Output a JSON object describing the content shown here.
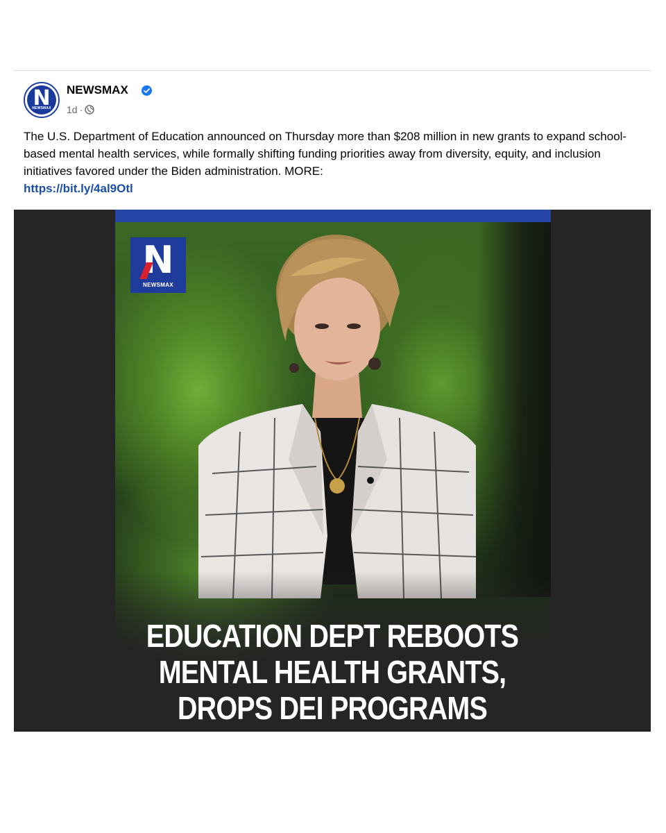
{
  "post": {
    "page_name": "NEWSMAX",
    "timestamp": "1d",
    "separator": "·",
    "verified": true,
    "visibility_icon": "globe-icon",
    "caption": "The U.S. Department of Education announced on Thursday more than $208 million in new grants to expand school-based mental health services, while formally shifting funding priorities away from diversity, equity, and inclusion initiatives favored under the Biden administration. MORE:",
    "link_text": "https://bit.ly/4al9Otl",
    "avatar": {
      "letter": "N",
      "word": "NEWSMAX"
    }
  },
  "media": {
    "logo": {
      "letter": "N",
      "word": "NEWSMAX"
    },
    "headline_lines": [
      "EDUCATION DEPT REBOOTS",
      "MENTAL HEALTH GRANTS,",
      "DROPS DEI PROGRAMS"
    ]
  },
  "colors": {
    "brand_blue": "#1f3c9c",
    "brand_red": "#d92030",
    "link_blue": "#1a4fa8",
    "verified_blue": "#1877f2",
    "media_background": "#252525"
  }
}
